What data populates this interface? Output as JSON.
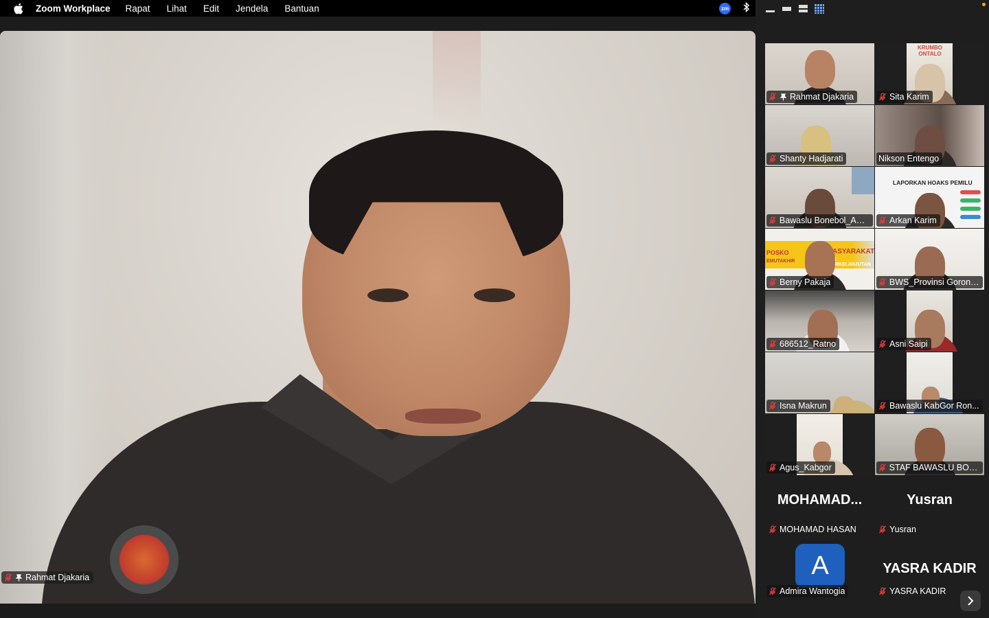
{
  "menubar": {
    "app_name": "Zoom Workplace",
    "items": [
      "Rapat",
      "Lihat",
      "Edit",
      "Jendela",
      "Bantuan"
    ],
    "zoom_badge": "zm"
  },
  "speaker": {
    "name": "Rahmat Djakaria",
    "muted": true,
    "pinned": true
  },
  "gallery": {
    "active_speaker_color": "#3fd35c",
    "participants": [
      {
        "name": "Rahmat Djakaria",
        "muted": true,
        "pinned": true
      },
      {
        "name": "Sita Karim",
        "muted": true
      },
      {
        "name": "Shanty Hadjarati",
        "muted": true
      },
      {
        "name": "Nikson Entengo",
        "muted": false,
        "active": true
      },
      {
        "name": "Bawaslu Bonebol_Am...",
        "muted": true
      },
      {
        "name": "Arkan Karim",
        "muted": true
      },
      {
        "name": "Berny Pakaja",
        "muted": true
      },
      {
        "name": "BWS_Provinsi Goront...",
        "muted": true
      },
      {
        "name": "686512_Ratno",
        "muted": true
      },
      {
        "name": "Asni Saipi",
        "muted": true
      },
      {
        "name": "Isna Makrun",
        "muted": true
      },
      {
        "name": "Bawaslu KabGor Ron...",
        "muted": true
      },
      {
        "name": "Agus_Kabgor",
        "muted": true
      },
      {
        "name": "STAF BAWASLU BOA...",
        "muted": true
      },
      {
        "name": "MOHAMAD HASAN",
        "display": "MOHAMAD...",
        "muted": true,
        "video_off": true
      },
      {
        "name": "Yusran",
        "display": "Yusran",
        "muted": true,
        "video_off": true
      },
      {
        "name": "Admira Wantogia",
        "avatar_letter": "A",
        "muted": true,
        "video_off": true
      },
      {
        "name": "YASRA KADIR",
        "display": "YASRA KADIR",
        "muted": true,
        "video_off": true
      }
    ],
    "tile_texts": {
      "arkan_banner": "LAPORKAN HOAKS PEMILU",
      "berny_banner1": "POSKO",
      "berny_banner2": "ASYARAKAT",
      "berny_banner3": "EMUTAKHIR",
      "berny_banner4": "LIH BERKELANJUTAN",
      "sita_banner": "KRUMBO ONTALO"
    }
  }
}
